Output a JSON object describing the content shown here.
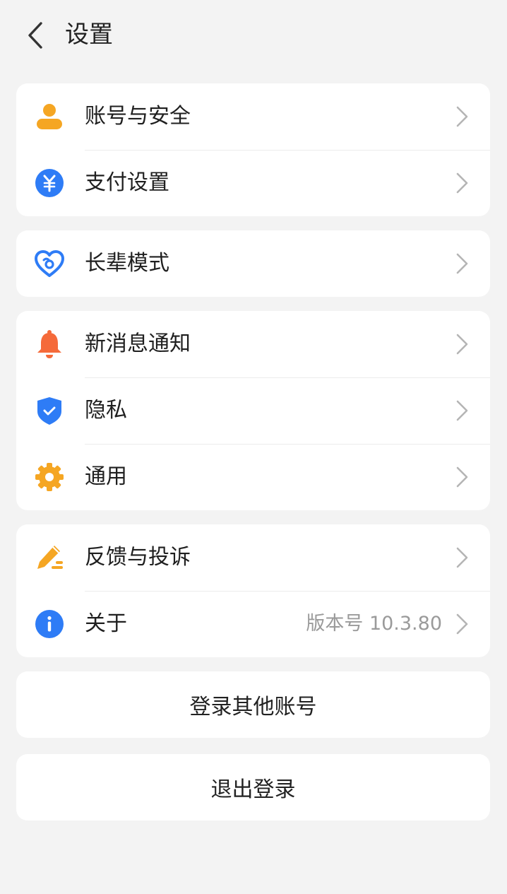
{
  "header": {
    "title": "设置"
  },
  "groups": [
    {
      "items": [
        {
          "icon": "user-icon",
          "label": "账号与安全"
        },
        {
          "icon": "payment-yuan-icon",
          "label": "支付设置"
        }
      ]
    },
    {
      "items": [
        {
          "icon": "heart-elder-icon",
          "label": "长辈模式"
        }
      ]
    },
    {
      "items": [
        {
          "icon": "bell-icon",
          "label": "新消息通知"
        },
        {
          "icon": "shield-check-icon",
          "label": "隐私"
        },
        {
          "icon": "gear-icon",
          "label": "通用"
        }
      ]
    },
    {
      "items": [
        {
          "icon": "pencil-feedback-icon",
          "label": "反馈与投诉"
        },
        {
          "icon": "info-icon",
          "label": "关于",
          "value": "版本号 10.3.80"
        }
      ]
    }
  ],
  "actions": {
    "switch_account": "登录其他账号",
    "logout": "退出登录"
  },
  "colors": {
    "background": "#f3f3f3",
    "orange": "#f5a623",
    "blue": "#2e7cf6",
    "red": "#f56a3a"
  }
}
